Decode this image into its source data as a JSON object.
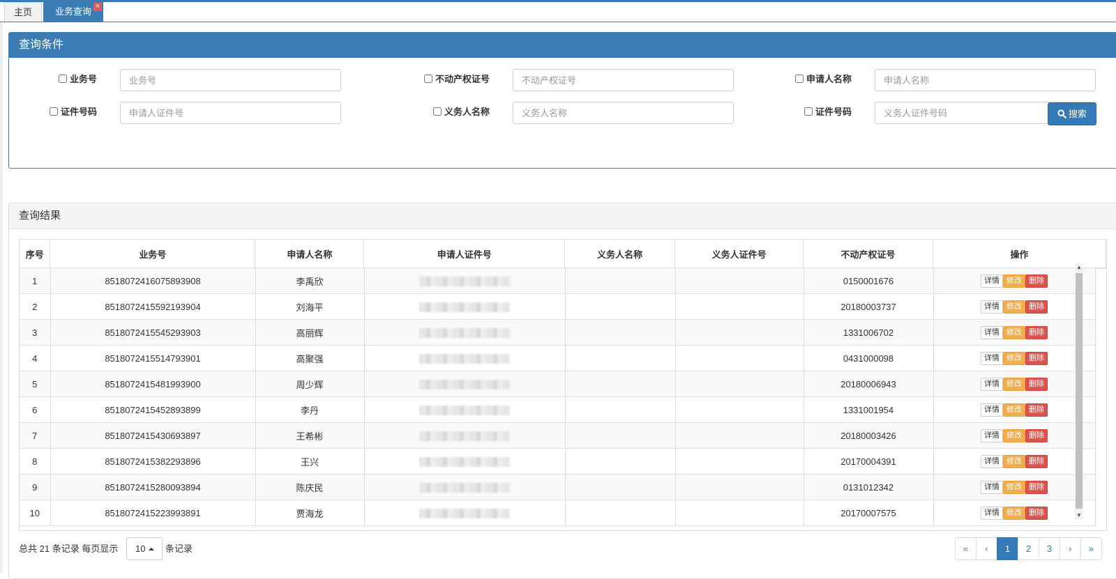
{
  "tabs": {
    "home": "主页",
    "active": "业务查询",
    "close_glyph": "×"
  },
  "query": {
    "title": "查询条件",
    "fields": {
      "business_no": {
        "label": "业务号",
        "placeholder": "业务号"
      },
      "property_cert_no": {
        "label": "不动产权证号",
        "placeholder": "不动产权证号"
      },
      "applicant_name": {
        "label": "申请人名称",
        "placeholder": "申请人名称"
      },
      "applicant_id": {
        "label": "证件号码",
        "placeholder": "申请人证件号"
      },
      "obligor_name": {
        "label": "义务人名称",
        "placeholder": "义务人名称"
      },
      "obligor_id": {
        "label": "证件号码",
        "placeholder": "义务人证件号码"
      }
    },
    "search_label": "搜索",
    "search_icon": "search-icon"
  },
  "results": {
    "title": "查询结果",
    "headers": {
      "index": "序号",
      "business_no": "业务号",
      "applicant_name": "申请人名称",
      "applicant_id": "申请人证件号",
      "obligor_name": "义务人名称",
      "obligor_id": "义务人证件号",
      "property_cert_no": "不动产权证号",
      "actions": "操作"
    },
    "rows": [
      {
        "index": "1",
        "business_no": "8518072416075893908",
        "applicant_name": "李禹欣",
        "obligor_name": "",
        "obligor_id": "",
        "property_cert_no": "0150001676"
      },
      {
        "index": "2",
        "business_no": "8518072415592193904",
        "applicant_name": "刘海平",
        "obligor_name": "",
        "obligor_id": "",
        "property_cert_no": "20180003737"
      },
      {
        "index": "3",
        "business_no": "8518072415545293903",
        "applicant_name": "高丽辉",
        "obligor_name": "",
        "obligor_id": "",
        "property_cert_no": "1331006702"
      },
      {
        "index": "4",
        "business_no": "8518072415514793901",
        "applicant_name": "高聚强",
        "obligor_name": "",
        "obligor_id": "",
        "property_cert_no": "0431000098"
      },
      {
        "index": "5",
        "business_no": "8518072415481993900",
        "applicant_name": "周少辉",
        "obligor_name": "",
        "obligor_id": "",
        "property_cert_no": "20180006943"
      },
      {
        "index": "6",
        "business_no": "8518072415452893899",
        "applicant_name": "李丹",
        "obligor_name": "",
        "obligor_id": "",
        "property_cert_no": "1331001954"
      },
      {
        "index": "7",
        "business_no": "8518072415430693897",
        "applicant_name": "王希彬",
        "obligor_name": "",
        "obligor_id": "",
        "property_cert_no": "20180003426"
      },
      {
        "index": "8",
        "business_no": "8518072415382293896",
        "applicant_name": "王兴",
        "obligor_name": "",
        "obligor_id": "",
        "property_cert_no": "20170004391"
      },
      {
        "index": "9",
        "business_no": "8518072415280093894",
        "applicant_name": "陈庆民",
        "obligor_name": "",
        "obligor_id": "",
        "property_cert_no": "0131012342"
      },
      {
        "index": "10",
        "business_no": "8518072415223993891",
        "applicant_name": "贾海龙",
        "obligor_name": "",
        "obligor_id": "",
        "property_cert_no": "20170007575"
      }
    ],
    "actions": {
      "detail": "详情",
      "edit": "修改",
      "delete": "删除"
    }
  },
  "footer": {
    "total_prefix": "总共",
    "total": "21",
    "total_suffix": "条记录",
    "per_page_prefix": "每页显示",
    "page_size": "10",
    "per_page_suffix": "条记录"
  },
  "pagination": {
    "first": "«",
    "prev": "‹",
    "pages": [
      "1",
      "2",
      "3"
    ],
    "current": "1",
    "next": "›",
    "last": "»"
  },
  "colors": {
    "primary": "#3c7cb5",
    "warning": "#f0ad4e",
    "danger": "#d9534f"
  }
}
